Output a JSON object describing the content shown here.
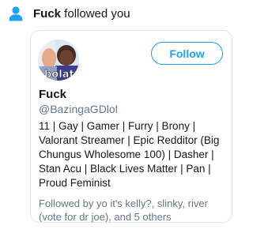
{
  "notification": {
    "user_name": "Fuck",
    "action_text": " followed you",
    "icon": "person-icon",
    "icon_color": "#1da1f2"
  },
  "card": {
    "avatar_text": "bolat",
    "follow_button_label": "Follow",
    "display_name": "Fuck",
    "handle": "@BazingaGDlol",
    "bio": "11 | Gay | Gamer | Furry | Brony | Valorant Streamer | Epic Redditor (Big Chungus Wholesome 100) | Dasher | Stan Acu | Black Lives Matter | Pan | Proud Feminist",
    "followed_by": "Followed by yo it's kelly?, slinky, river (vote for dr joe), and 5 others"
  },
  "colors": {
    "accent": "#1da1f2",
    "text_primary": "#14171a",
    "text_secondary": "#657786",
    "border": "#dfe5ea"
  }
}
